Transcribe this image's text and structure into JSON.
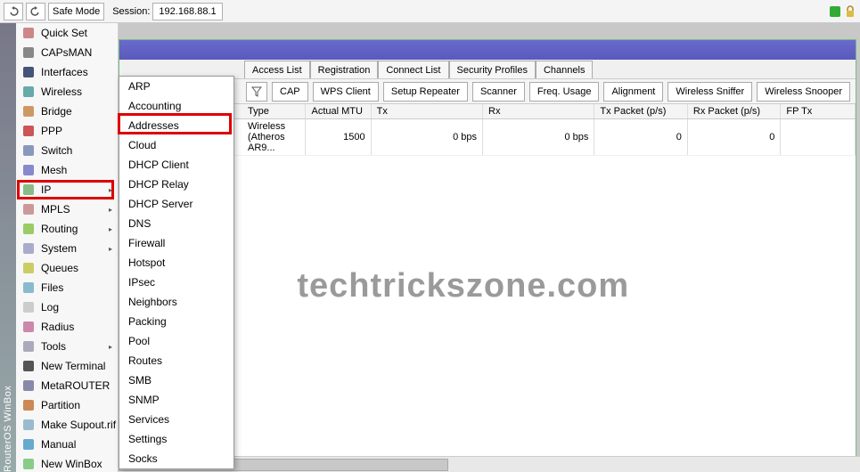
{
  "toolbar": {
    "safe_mode": "Safe Mode",
    "session_label": "Session:",
    "session_value": "192.168.88.1"
  },
  "vtitle": "RouterOS WinBox",
  "sidebar": [
    {
      "label": "Quick Set",
      "icon": "#c88",
      "name": "quick-set"
    },
    {
      "label": "CAPsMAN",
      "icon": "#888",
      "name": "capsman"
    },
    {
      "label": "Interfaces",
      "icon": "#457",
      "name": "interfaces"
    },
    {
      "label": "Wireless",
      "icon": "#6aa",
      "name": "wireless"
    },
    {
      "label": "Bridge",
      "icon": "#c96",
      "name": "bridge"
    },
    {
      "label": "PPP",
      "icon": "#c55",
      "name": "ppp"
    },
    {
      "label": "Switch",
      "icon": "#89b",
      "name": "switch"
    },
    {
      "label": "Mesh",
      "icon": "#88c",
      "name": "mesh"
    },
    {
      "label": "IP",
      "icon": "#8b8",
      "name": "ip",
      "arrow": true
    },
    {
      "label": "MPLS",
      "icon": "#c99",
      "name": "mpls",
      "arrow": true
    },
    {
      "label": "Routing",
      "icon": "#9c6",
      "name": "routing",
      "arrow": true
    },
    {
      "label": "System",
      "icon": "#aac",
      "name": "system",
      "arrow": true
    },
    {
      "label": "Queues",
      "icon": "#cc6",
      "name": "queues"
    },
    {
      "label": "Files",
      "icon": "#8bc",
      "name": "files"
    },
    {
      "label": "Log",
      "icon": "#ccc",
      "name": "log"
    },
    {
      "label": "Radius",
      "icon": "#c8a",
      "name": "radius"
    },
    {
      "label": "Tools",
      "icon": "#aab",
      "name": "tools",
      "arrow": true
    },
    {
      "label": "New Terminal",
      "icon": "#555",
      "name": "new-terminal"
    },
    {
      "label": "MetaROUTER",
      "icon": "#88a",
      "name": "metarouter"
    },
    {
      "label": "Partition",
      "icon": "#c85",
      "name": "partition"
    },
    {
      "label": "Make Supout.rif",
      "icon": "#9bc",
      "name": "make-supout"
    },
    {
      "label": "Manual",
      "icon": "#6ac",
      "name": "manual"
    },
    {
      "label": "New WinBox",
      "icon": "#8c8",
      "name": "new-winbox"
    }
  ],
  "submenu": [
    "ARP",
    "Accounting",
    "Addresses",
    "Cloud",
    "DHCP Client",
    "DHCP Relay",
    "DHCP Server",
    "DNS",
    "Firewall",
    "Hotspot",
    "IPsec",
    "Neighbors",
    "Packing",
    "Pool",
    "Routes",
    "SMB",
    "SNMP",
    "Services",
    "Settings",
    "Socks"
  ],
  "tabs": [
    "Access List",
    "Registration",
    "Connect List",
    "Security Profiles",
    "Channels"
  ],
  "toolbtns": [
    "CAP",
    "WPS Client",
    "Setup Repeater",
    "Scanner",
    "Freq. Usage",
    "Alignment",
    "Wireless Sniffer",
    "Wireless Snooper"
  ],
  "table": {
    "headers": [
      "Type",
      "Actual MTU",
      "Tx",
      "Rx",
      "Tx Packet (p/s)",
      "Rx Packet (p/s)",
      "FP Tx"
    ],
    "row": {
      "type": "Wireless (Atheros AR9...",
      "mtu": "1500",
      "tx": "0 bps",
      "rx": "0 bps",
      "txp": "0",
      "rxp": "0",
      "fptx": ""
    }
  },
  "watermark": "techtrickszone.com"
}
